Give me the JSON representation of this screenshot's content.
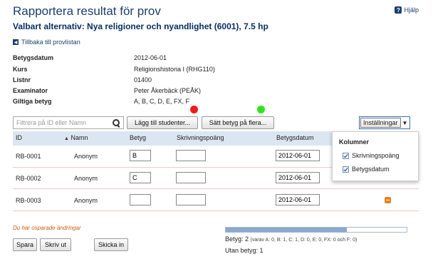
{
  "page": {
    "title": "Rapportera resultat för prov",
    "subtitle": "Valbart alternativ: Nya religioner och nyandlighet (6001), 7.5 hp",
    "help_label": "Hjälp",
    "back_label": "Tillbaka till provlistan"
  },
  "info": [
    {
      "label": "Betygsdatum",
      "value": "2012-06-01"
    },
    {
      "label": "Kurs",
      "value": "Religionshistoria I (RHG110)"
    },
    {
      "label": "Listnr",
      "value": "01400"
    },
    {
      "label": "Examinator",
      "value": "Peter Åkerbäck (PEÅK)"
    },
    {
      "label": "Giltiga betyg",
      "value": "A, B, C, D, E, FX, F"
    }
  ],
  "toolbar": {
    "filter_placeholder": "Filtrera på ID eller Namn",
    "add_students_label": "Lägg till studenter...",
    "set_grades_label": "Sätt betyg på flera...",
    "settings_label": "Inställningar",
    "markers": {
      "red": "#ee1c1c",
      "green": "#34e31f"
    }
  },
  "table": {
    "columns": [
      "ID",
      "Namn",
      "Betyg",
      "Skrivningspoäng",
      "Betygsdatum"
    ],
    "rows": [
      {
        "id": "RB-0001",
        "name": "Anonym",
        "grade": "B",
        "points": "",
        "date": "2012-06-01"
      },
      {
        "id": "RB-0002",
        "name": "Anonym",
        "grade": "C",
        "points": "",
        "date": "2012-06-01"
      },
      {
        "id": "RB-0003",
        "name": "Anonym",
        "grade": "",
        "points": "",
        "date": "2012-06-01"
      }
    ]
  },
  "columns_menu": {
    "title": "Kolumner",
    "items": [
      {
        "label": "Skrivningspoäng",
        "checked": true
      },
      {
        "label": "Betygsdatum",
        "checked": true
      }
    ]
  },
  "footer": {
    "unsaved_notice": "Du har osparade ändringar",
    "save_label": "Spara",
    "print_label": "Skriv ut",
    "send_label": "Skicka in",
    "progress_fraction": 0.67,
    "grade_count_label": "Betyg: 2",
    "grade_breakdown": "(varav A: 0, B: 1, C: 1, D: 0, E: 0, FX: 0 och F: 0)",
    "ungraded_label": "Utan betyg: 1"
  },
  "colors": {
    "title": "#1c3f6e",
    "header_bg": "#dce6f1",
    "unsaved": "#d05a10",
    "row_icon": "#e8831c"
  }
}
